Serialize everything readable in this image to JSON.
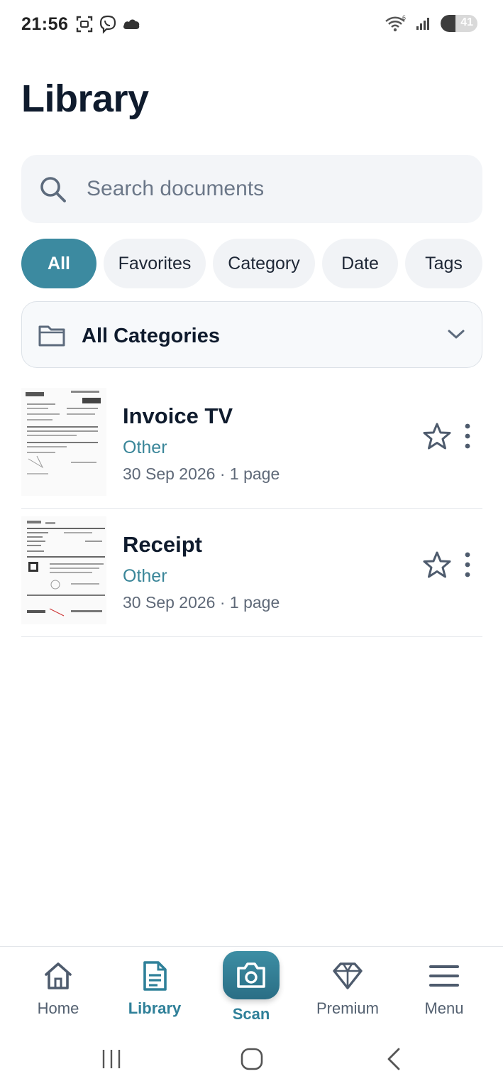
{
  "status_bar": {
    "time": "21:56",
    "battery_level": "41",
    "battery_fraction": 0.41,
    "icons_left": [
      "screenshot-icon",
      "viber-icon",
      "cloud-icon"
    ],
    "icons_right": [
      "wifi-icon",
      "signal-icon",
      "battery-icon"
    ]
  },
  "header": {
    "title": "Library"
  },
  "search": {
    "placeholder": "Search documents",
    "value": ""
  },
  "filters": [
    {
      "label": "All",
      "active": true
    },
    {
      "label": "Favorites",
      "active": false
    },
    {
      "label": "Category",
      "active": false
    },
    {
      "label": "Date",
      "active": false
    },
    {
      "label": "Tags",
      "active": false
    }
  ],
  "category_select": {
    "selected": "All Categories"
  },
  "documents": [
    {
      "title": "Invoice TV",
      "category": "Other",
      "meta": "30 Sep 2026 · 1 page",
      "favorite": false
    },
    {
      "title": "Receipt",
      "category": "Other",
      "meta": "30 Sep 2026 · 1 page",
      "favorite": false
    }
  ],
  "bottom_nav": [
    {
      "label": "Home",
      "icon": "home-icon",
      "active": false
    },
    {
      "label": "Library",
      "icon": "document-icon",
      "active": true
    },
    {
      "label": "Scan",
      "icon": "camera-icon",
      "active": false
    },
    {
      "label": "Premium",
      "icon": "diamond-icon",
      "active": false
    },
    {
      "label": "Menu",
      "icon": "hamburger-icon",
      "active": false
    }
  ],
  "colors": {
    "accent": "#3c8aa0",
    "accent_text": "#2f8099",
    "title": "#0f1b2d",
    "muted": "#5f6978",
    "surface": "#f3f5f8"
  }
}
